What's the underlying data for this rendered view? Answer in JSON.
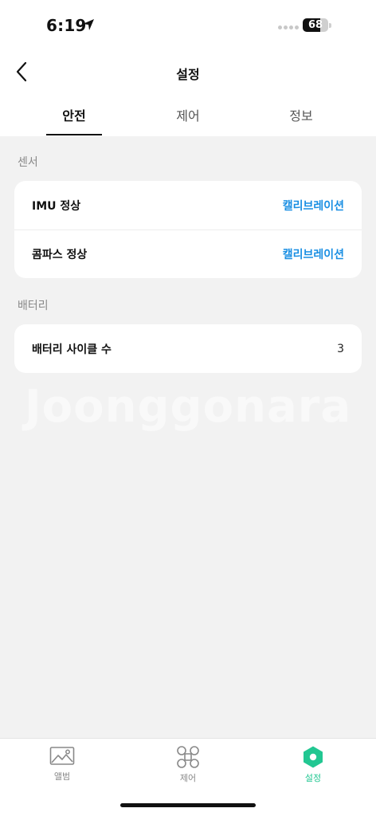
{
  "status_bar": {
    "time": "6:19",
    "battery_level": "68",
    "battery_fraction": 0.68
  },
  "header": {
    "title": "설정"
  },
  "tabs": [
    {
      "label": "안전",
      "active": true
    },
    {
      "label": "제어",
      "active": false
    },
    {
      "label": "정보",
      "active": false
    }
  ],
  "sections": {
    "sensor": {
      "label": "센서",
      "rows": [
        {
          "label": "IMU 정상",
          "action": "캘리브레이션"
        },
        {
          "label": "콤파스 정상",
          "action": "캘리브레이션"
        }
      ]
    },
    "battery": {
      "label": "배터리",
      "rows": [
        {
          "label": "배터리 사이클 수",
          "value": "3"
        }
      ]
    }
  },
  "watermark": "Joonggonara",
  "bottom_nav": [
    {
      "label": "앨범",
      "icon": "image-icon",
      "active": false
    },
    {
      "label": "제어",
      "icon": "drone-icon",
      "active": false
    },
    {
      "label": "설정",
      "icon": "settings-hex-icon",
      "active": true
    }
  ],
  "colors": {
    "accent_blue": "#1a8fe3",
    "accent_green": "#22c792"
  }
}
